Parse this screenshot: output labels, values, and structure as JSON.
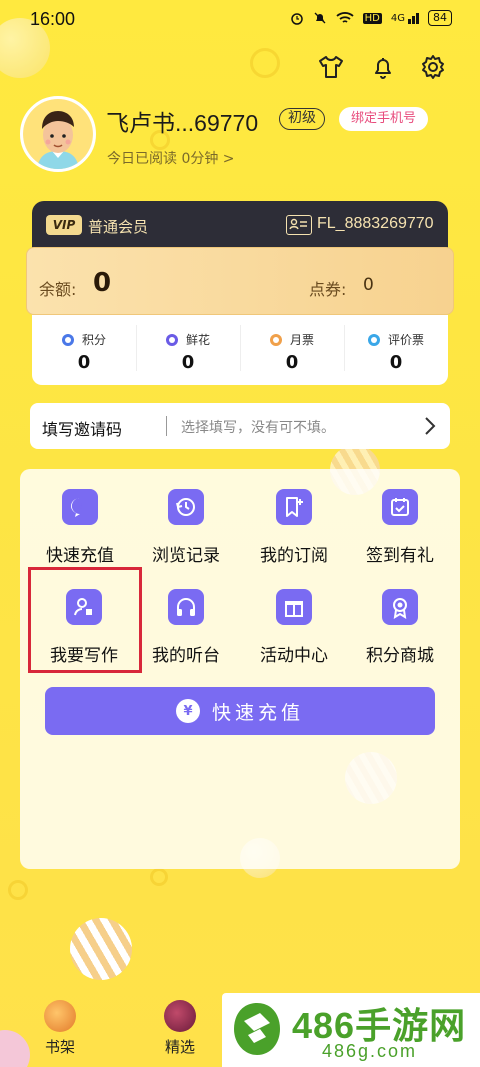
{
  "status_bar": {
    "time": "16:00",
    "hd_label": "HD",
    "network_label": "4G",
    "battery": "84"
  },
  "header": {
    "icons": [
      "tshirt-icon",
      "bell-icon",
      "gear-icon"
    ]
  },
  "profile": {
    "username": "飞卢书...69770",
    "level": "初级",
    "bind_phone": "绑定手机号",
    "read_today": "今日已阅读 0分钟 >"
  },
  "vip": {
    "badge": "VIP",
    "label": "普通会员",
    "user_id": "FL_8883269770"
  },
  "balance": {
    "label": "余额:",
    "value": "0",
    "coupon_label": "点券:",
    "coupon_value": "0"
  },
  "stats": [
    {
      "label": "积分",
      "value": "0",
      "color": "#4a78e8"
    },
    {
      "label": "鲜花",
      "value": "0",
      "color": "#6a5be6"
    },
    {
      "label": "月票",
      "value": "0",
      "color": "#f0a04a"
    },
    {
      "label": "评价票",
      "value": "0",
      "color": "#3aa7e8"
    }
  ],
  "invite": {
    "label": "填写邀请码",
    "placeholder": "选择填写，没有可不填。"
  },
  "services": [
    {
      "label": "快速充值",
      "icon": "yuan-chat-icon"
    },
    {
      "label": "浏览记录",
      "icon": "history-icon"
    },
    {
      "label": "我的订阅",
      "icon": "bookmark-add-icon"
    },
    {
      "label": "签到有礼",
      "icon": "calendar-check-icon"
    },
    {
      "label": "我要写作",
      "icon": "user-pen-icon"
    },
    {
      "label": "我的听台",
      "icon": "headphones-icon"
    },
    {
      "label": "活动中心",
      "icon": "gift-icon"
    },
    {
      "label": "积分商城",
      "icon": "medal-icon"
    }
  ],
  "recharge_button": {
    "label": "快速充值",
    "icon_text": "¥"
  },
  "bottom_nav": [
    {
      "label": "书架"
    },
    {
      "label": "精选"
    }
  ],
  "watermark": {
    "title": "486手游网",
    "subtitle": "486g.com"
  },
  "colors": {
    "accent": "#7a6bf2",
    "background": "#ffe93f",
    "vip_card": "#2d2d37",
    "highlight": "#d8273a"
  }
}
